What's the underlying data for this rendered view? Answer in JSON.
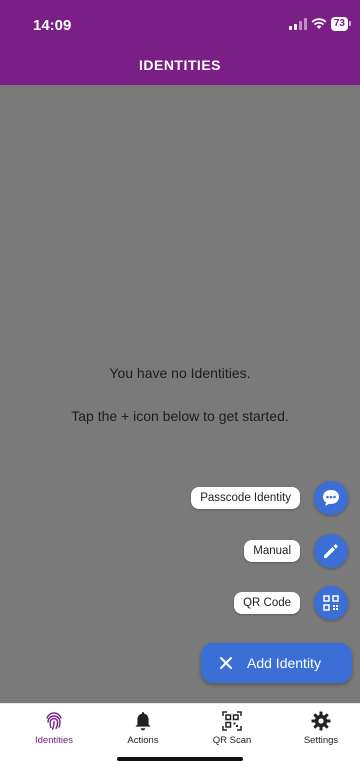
{
  "status_bar": {
    "time": "14:09",
    "battery": "73"
  },
  "header": {
    "title": "IDENTITIES"
  },
  "empty_state": {
    "line1": "You have no Identities.",
    "line2": "Tap the + icon below to get started."
  },
  "fab_menu": {
    "items": [
      {
        "label": "Passcode Identity",
        "icon": "chat-bubble-icon"
      },
      {
        "label": "Manual",
        "icon": "pencil-icon"
      },
      {
        "label": "QR Code",
        "icon": "qr-code-icon"
      }
    ],
    "main": {
      "label": "Add Identity",
      "icon": "close-icon"
    }
  },
  "bottom_nav": {
    "items": [
      {
        "label": "Identities",
        "icon": "fingerprint-icon",
        "active": true
      },
      {
        "label": "Actions",
        "icon": "bell-icon",
        "active": false
      },
      {
        "label": "QR Scan",
        "icon": "qr-scan-icon",
        "active": false
      },
      {
        "label": "Settings",
        "icon": "gear-icon",
        "active": false
      }
    ]
  },
  "colors": {
    "brand": "#7a1f86",
    "accent": "#3c6fd6",
    "overlay": "#7a7a7a"
  }
}
